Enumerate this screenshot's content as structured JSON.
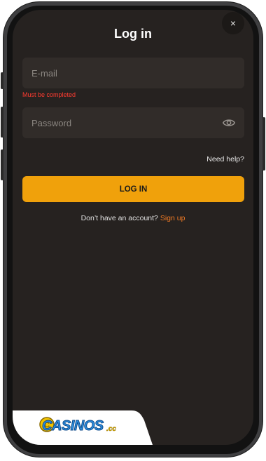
{
  "dialog": {
    "title": "Log in",
    "close_label": "×"
  },
  "email": {
    "placeholder": "E-mail",
    "value": "",
    "error": "Must be completed"
  },
  "password": {
    "placeholder": "Password",
    "value": "",
    "visibility_icon": "eye-icon"
  },
  "help_link": "Need help?",
  "login_button": "LOG IN",
  "signup": {
    "prompt": "Don’t have an account?",
    "link": "Sign up"
  },
  "watermark": {
    "text": "CASINOS",
    "tld": ".cc"
  },
  "colors": {
    "background": "#262220",
    "field": "#312c29",
    "accent": "#f0a10b",
    "link": "#f07a24",
    "error": "#ff3b30"
  }
}
